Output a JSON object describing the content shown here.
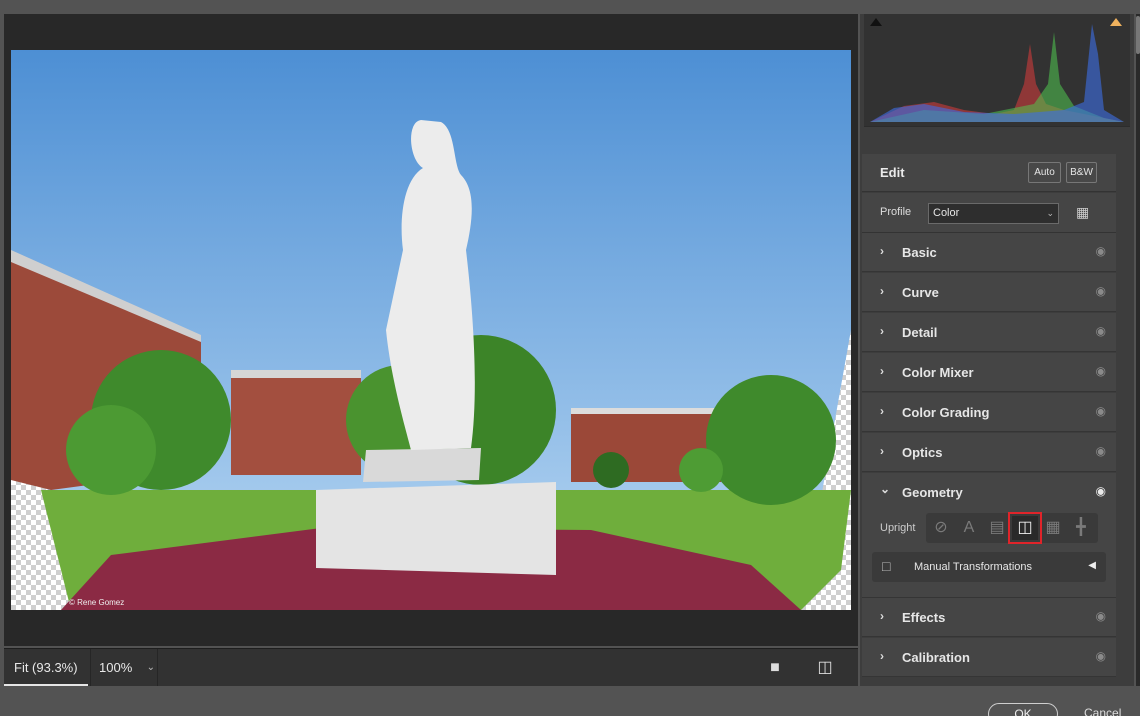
{
  "canvas": {
    "watermark": "© Rene Gomez"
  },
  "bottom_bar": {
    "fit_label": "Fit (93.3%)",
    "zoom_value": "100%"
  },
  "edit": {
    "title": "Edit",
    "auto_label": "Auto",
    "bw_label": "B&W"
  },
  "profile": {
    "label": "Profile",
    "value": "Color"
  },
  "sections": [
    {
      "label": "Basic",
      "expanded": false
    },
    {
      "label": "Curve",
      "expanded": false
    },
    {
      "label": "Detail",
      "expanded": false
    },
    {
      "label": "Color Mixer",
      "expanded": false
    },
    {
      "label": "Color Grading",
      "expanded": false
    },
    {
      "label": "Optics",
      "expanded": false
    },
    {
      "label": "Geometry",
      "expanded": true
    },
    {
      "label": "Effects",
      "expanded": false
    },
    {
      "label": "Calibration",
      "expanded": false
    }
  ],
  "geometry": {
    "upright_label": "Upright",
    "selected_mode": "vertical",
    "manual_label": "Manual Transformations"
  },
  "footer": {
    "ok_label": "OK",
    "cancel_label": "Cancel"
  },
  "colors": {
    "highlight": "#e0242a",
    "panel_bg": "#454545"
  }
}
